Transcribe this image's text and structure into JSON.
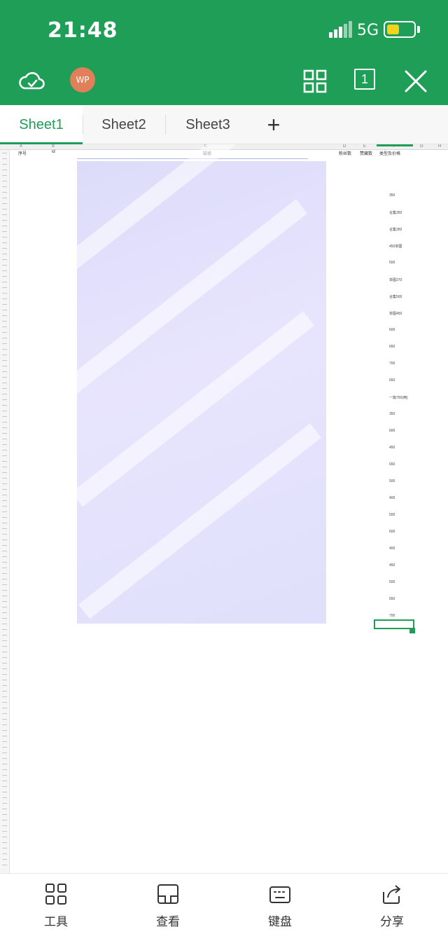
{
  "status_bar": {
    "time": "21:48",
    "network": "5G",
    "battery_level": 0.45
  },
  "toolbar": {
    "avatar_text": "WP",
    "page_count": "1",
    "icons": [
      "cloud-sync-icon",
      "grid-view-icon",
      "page-counter-icon",
      "close-icon"
    ]
  },
  "sheet_tabs": [
    {
      "label": "Sheet1",
      "active": true
    },
    {
      "label": "Sheet2",
      "active": false
    },
    {
      "label": "Sheet3",
      "active": false
    }
  ],
  "add_tab_label": "+",
  "spreadsheet": {
    "column_letters": [
      "A",
      "B",
      "C",
      "D",
      "E",
      "F",
      "G",
      "H"
    ],
    "header_row": [
      "序号",
      "id",
      "链接",
      "粉丝数",
      "赞藏数",
      "类型及价格"
    ],
    "right_values": [
      "350",
      "合集350",
      "合集350",
      "450单图",
      "500",
      "单图270",
      "合集500",
      "单图450",
      "600",
      "650",
      "700",
      "650",
      "一篇750(两)",
      "350",
      "600",
      "450",
      "650",
      "500",
      "400",
      "500",
      "600",
      "400",
      "450",
      "500",
      "650",
      "700"
    ]
  },
  "bottom_bar": [
    {
      "label": "工具",
      "icon": "tools-icon"
    },
    {
      "label": "查看",
      "icon": "view-icon"
    },
    {
      "label": "键盘",
      "icon": "keyboard-icon"
    },
    {
      "label": "分享",
      "icon": "share-icon"
    }
  ],
  "colors": {
    "accent": "#1e9e56",
    "redaction": "#dcdcfa",
    "avatar": "#e0805a",
    "battery": "#f7d21a"
  }
}
